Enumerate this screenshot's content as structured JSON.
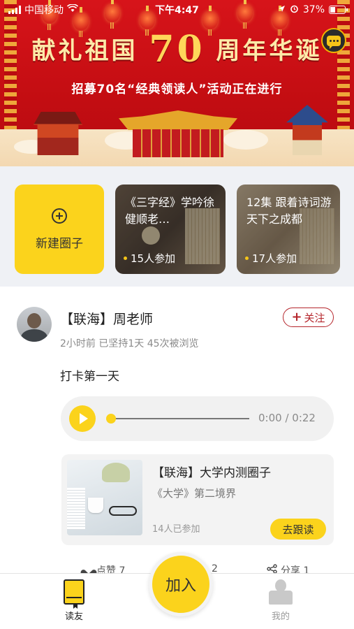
{
  "status_bar": {
    "carrier": "中国移动",
    "time": "下午4:47",
    "battery": "37%",
    "battery_level": 0.37
  },
  "banner": {
    "title_prefix": "献礼祖国",
    "title_number": "70",
    "title_suffix": "周年华诞",
    "subtitle": "招募70名“经典领读人”活动正在进行"
  },
  "circles": {
    "new_circle_label": "新建圈子",
    "items": [
      {
        "title": "《三字经》学吟徐健顺老…",
        "count": "15人参加"
      },
      {
        "title": "12集 跟着诗词游天下之成都",
        "count": "17人参加"
      }
    ]
  },
  "post": {
    "author": "【联海】周老师",
    "follow_label": "关注",
    "meta": "2小时前 已坚持1天 45次被浏览",
    "text": "打卡第一天",
    "audio": {
      "time": "0:00 / 0:22",
      "progress": 0
    },
    "linked_circle": {
      "title": "【联海】大学内测圈子",
      "subtitle": "《大学》第二境界",
      "count": "14人已参加",
      "action_label": "去跟读"
    },
    "actions": {
      "like": "点赞 7",
      "comment": "2",
      "share": "分享 1"
    }
  },
  "tabbar": {
    "left_label": "读友",
    "center_label": "加入",
    "right_label": "我的"
  },
  "colors": {
    "accent_yellow": "#fbd31c",
    "banner_red": "#d7141a",
    "follow_red": "#b5262c"
  }
}
